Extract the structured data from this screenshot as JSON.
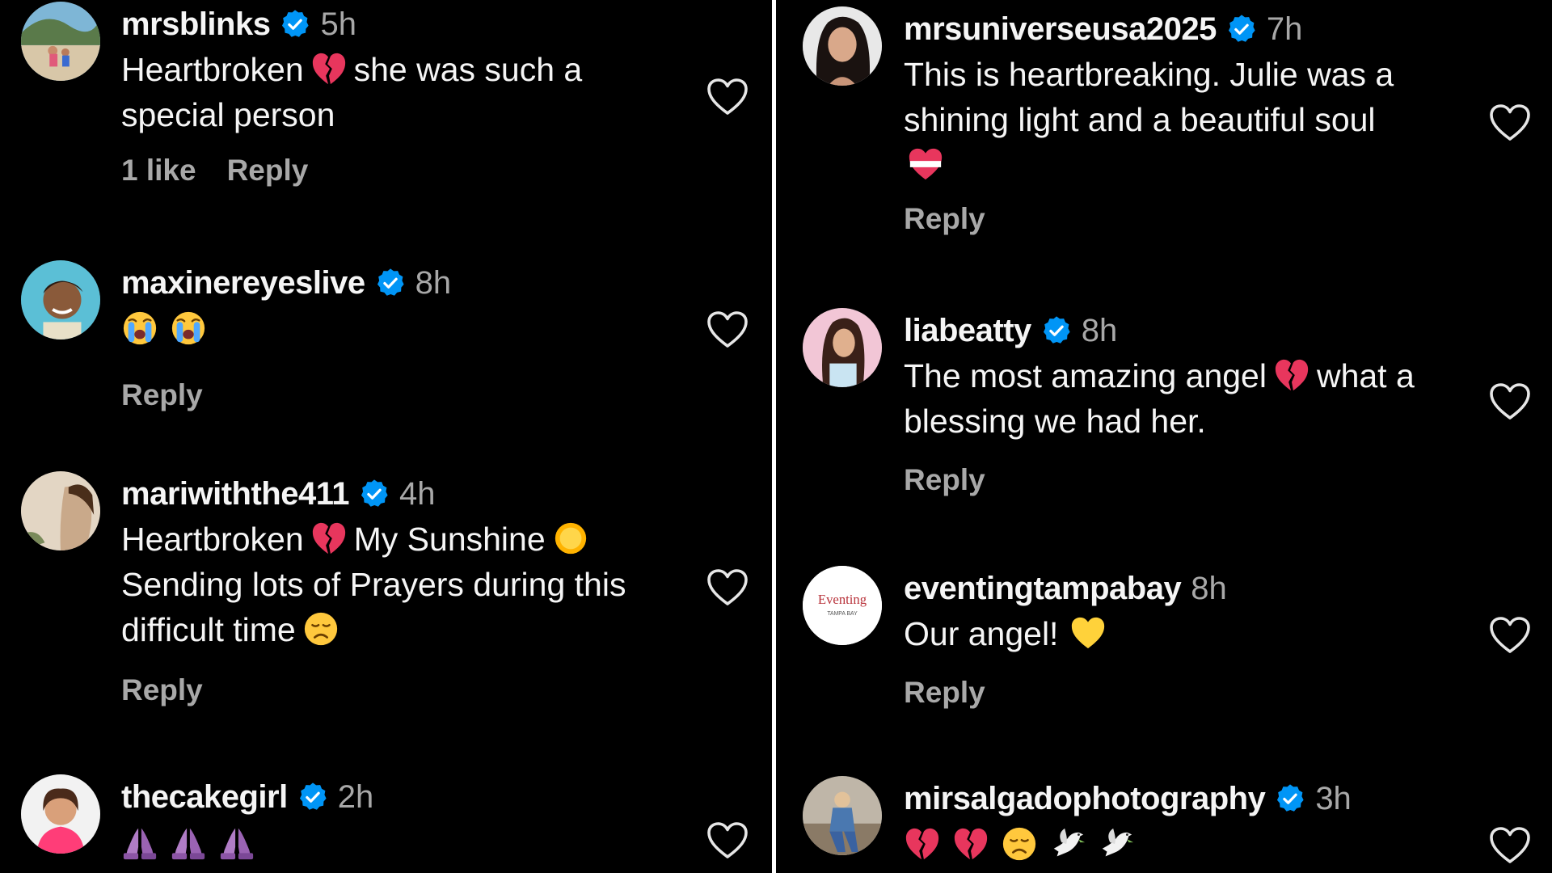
{
  "left": [
    {
      "user": "mrsblinks",
      "verified": true,
      "time": "5h",
      "text": [
        "Heartbroken",
        "she was such a",
        "special person"
      ],
      "likes": "1 like",
      "reply": "Reply"
    },
    {
      "user": "maxinereyeslive",
      "verified": true,
      "time": "8h",
      "emoji": [
        "crying-face",
        "crying-face"
      ],
      "reply": "Reply"
    },
    {
      "user": "mariwiththe411",
      "verified": true,
      "time": "4h",
      "text": [
        "Heartbroken",
        "My Sunshine",
        "Sending lots of Prayers during this",
        "difficult time"
      ],
      "reply": "Reply"
    },
    {
      "user": "thecakegirl",
      "verified": true,
      "time": "2h",
      "emoji": [
        "folded-hands",
        "folded-hands",
        "folded-hands"
      ]
    }
  ],
  "right": [
    {
      "user": "mrsuniverseusa2025",
      "verified": true,
      "time": "7h",
      "text": [
        "This is heartbreaking. Julie was a",
        "shining light and a beautiful soul"
      ],
      "reply": "Reply"
    },
    {
      "user": "liabeatty",
      "verified": true,
      "time": "8h",
      "text": [
        "The most amazing angel",
        "what a",
        "blessing we had her."
      ],
      "reply": "Reply"
    },
    {
      "user": "eventingtampabay",
      "verified": false,
      "time": "8h",
      "text": [
        "Our angel!"
      ],
      "reply": "Reply"
    },
    {
      "user": "mirsalgadophotography",
      "verified": true,
      "time": "3h",
      "emoji": [
        "broken-heart",
        "broken-heart",
        "disappointed-face",
        "dove",
        "dove"
      ]
    }
  ],
  "avatar_logo": {
    "main": "Eventing",
    "sub": "TAMPA BAY"
  },
  "colors": {
    "background": "#000000",
    "text": "#f5f5f5",
    "secondary": "#a8a8a8",
    "verified": "#0095f6"
  }
}
